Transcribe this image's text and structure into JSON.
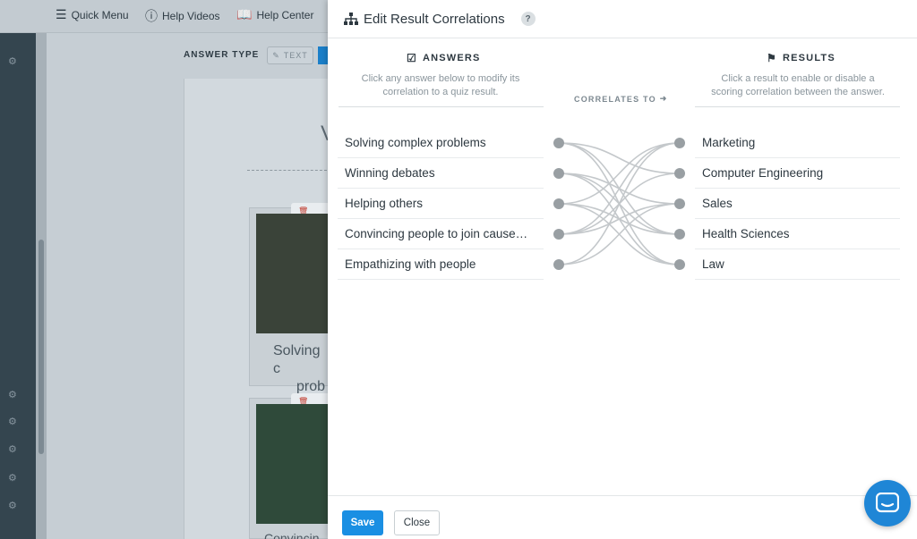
{
  "topbar": {
    "quick_menu": "Quick Menu",
    "help_videos": "Help Videos",
    "help_center": "Help Center"
  },
  "editor": {
    "answer_type_label": "ANSWER TYPE",
    "text_button": "TEXT",
    "big_letter": "V",
    "card1_caption_line1": "Solving c",
    "card1_caption_line2": "prob",
    "card2_caption": "Convincin"
  },
  "modal": {
    "title": "Edit Result Correlations",
    "help_label": "?",
    "answers_heading": "ANSWERS",
    "answers_desc_line1": "Click any answer below to modify its",
    "answers_desc_line2": "correlation to a quiz result.",
    "correlates_label": "CORRELATES TO",
    "results_heading": "RESULTS",
    "results_desc_line1": "Click a result to enable or disable a",
    "results_desc_line2": "scoring correlation between the answer.",
    "answers": [
      "Solving complex problems",
      "Winning debates",
      "Helping others",
      "Convincing people to join cause…",
      "Empathizing with people"
    ],
    "results": [
      "Marketing",
      "Computer Engineering",
      "Sales",
      "Health Sciences",
      "Law"
    ],
    "correlations": [
      [
        0,
        1
      ],
      [
        0,
        3
      ],
      [
        0,
        4
      ],
      [
        1,
        2
      ],
      [
        1,
        3
      ],
      [
        1,
        4
      ],
      [
        2,
        0
      ],
      [
        2,
        3
      ],
      [
        2,
        4
      ],
      [
        3,
        0
      ],
      [
        3,
        1
      ],
      [
        3,
        2
      ],
      [
        4,
        0
      ],
      [
        4,
        2
      ]
    ],
    "link_color": "#c4c8cb",
    "dot_color": "#999fa3",
    "save_label": "Save",
    "close_label": "Close"
  },
  "accent_color": "#1a8fe3"
}
